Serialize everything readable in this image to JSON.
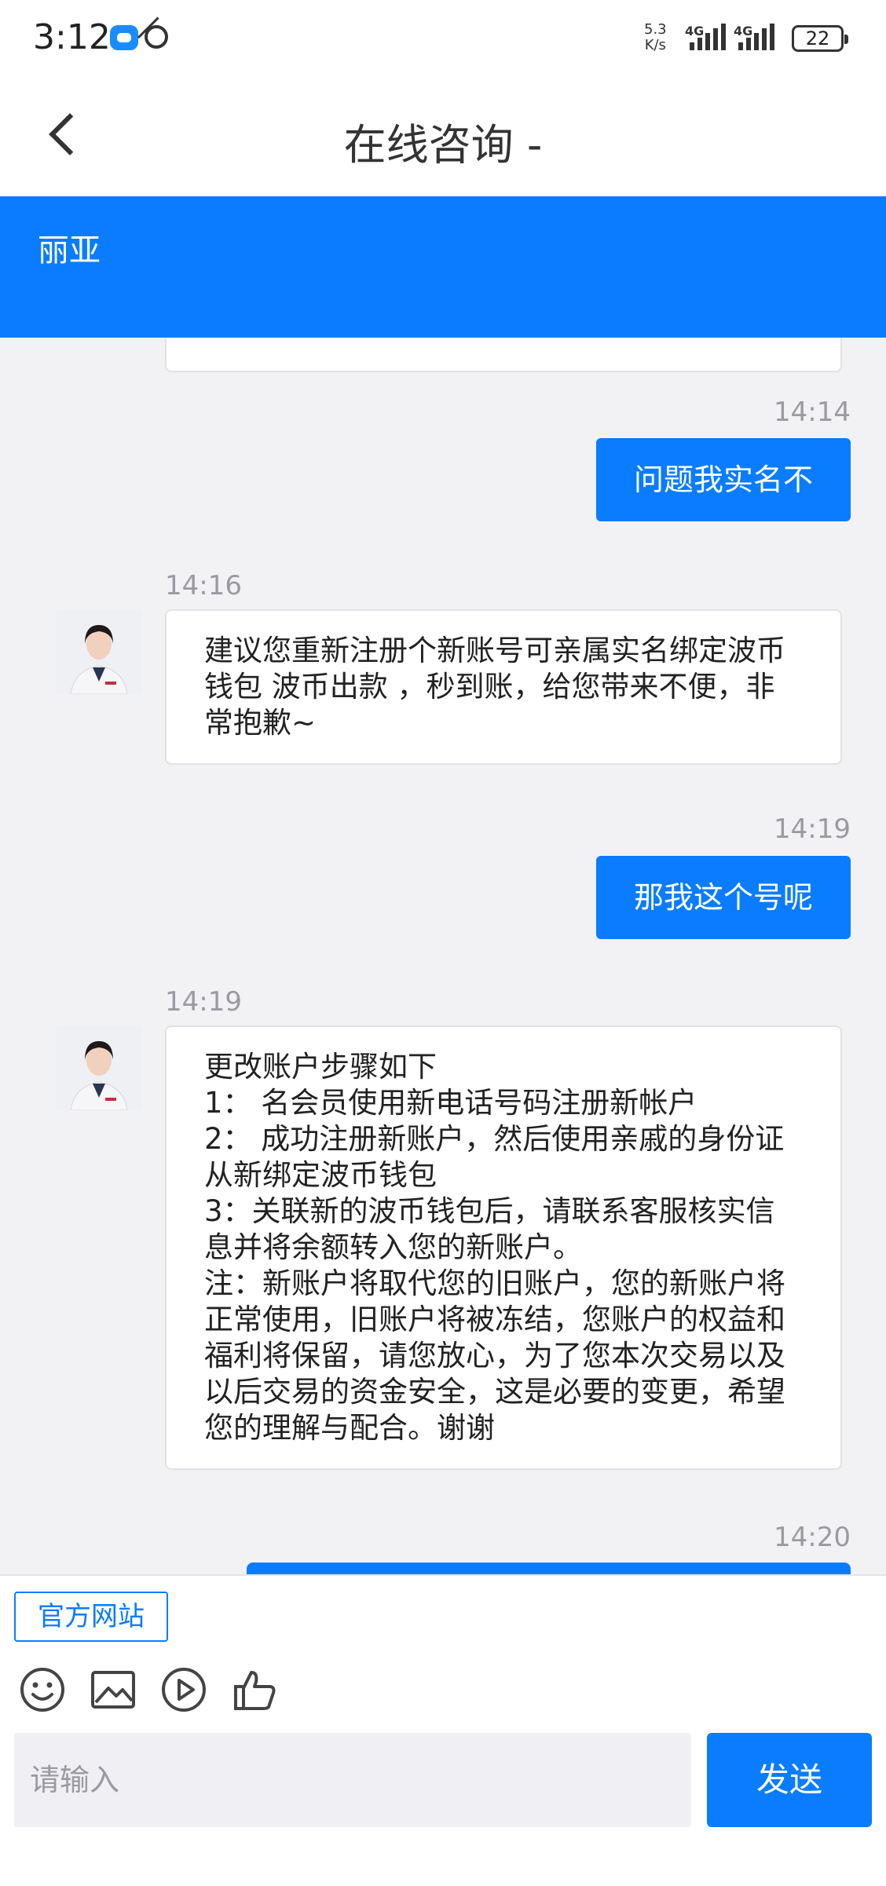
{
  "status_bar": {
    "time": "3:12",
    "net_speed_value": "5.3",
    "net_speed_unit": "K/s",
    "signal1_label": "4G",
    "signal2_label": "4G",
    "battery": "22"
  },
  "header": {
    "title": "在线咨询 -"
  },
  "banner": {
    "agent_name": "丽亚"
  },
  "messages": [
    {
      "time": "14:14",
      "direction": "out",
      "text": "问题我实名不"
    },
    {
      "time": "14:16",
      "direction": "in",
      "text": "建议您重新注册个新账号可亲属实名绑定波币钱包 波币出款 ，秒到账，给您带来不便，非常抱歉~"
    },
    {
      "time": "14:19",
      "direction": "out",
      "text": "那我这个号呢"
    },
    {
      "time": "14:19",
      "direction": "in",
      "text": "更改账户步骤如下\n1： 名会员使用新电话号码注册新帐户\n2： 成功注册新账户，然后使用亲戚的身份证从新绑定波币钱包\n3：关联新的波币钱包后，请联系客服核实信息并将余额转入您的新账户。\n注：新账户将取代您的旧账户，您的新账户将正常使用，旧账户将被冻结，您账户的权益和福利将保留，请您放心，为了您本次交易以及以后交易的资金安全，这是必要的变更，希望您的理解与配合。谢谢"
    },
    {
      "time": "14:20",
      "direction": "out",
      "text": ""
    }
  ],
  "bottom_bar": {
    "official_site_label": "官方网站",
    "input_placeholder": "请输入",
    "send_label": "发送"
  },
  "icons": [
    "emoji-icon",
    "image-icon",
    "video-icon",
    "thumbs-up-icon"
  ],
  "colors": {
    "accent": "#0a7cff",
    "background": "#f2f2f5",
    "timestamp": "#9a9aa0"
  }
}
